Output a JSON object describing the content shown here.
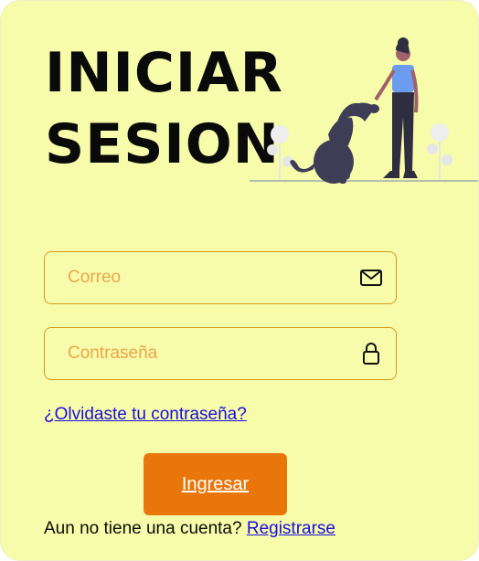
{
  "title": {
    "line1": "INICIAR",
    "line2": "SESION"
  },
  "form": {
    "email_placeholder": "Correo",
    "email_value": "",
    "email_icon": "envelope-icon",
    "password_placeholder": "Contraseña",
    "password_value": "",
    "password_icon": "lock-icon",
    "forgot_link": "¿Olvidaste tu contraseña?",
    "submit_label": "Ingresar"
  },
  "footer": {
    "prompt": "Aun no tiene una cuenta?",
    "register_link": "Registrarse"
  },
  "colors": {
    "background": "#f6fca9",
    "accent": "#e8760b",
    "field_border": "#d39a1e",
    "placeholder": "#eca54e",
    "link": "#1a0dde"
  },
  "illustration": "woman-and-dog-illustration"
}
